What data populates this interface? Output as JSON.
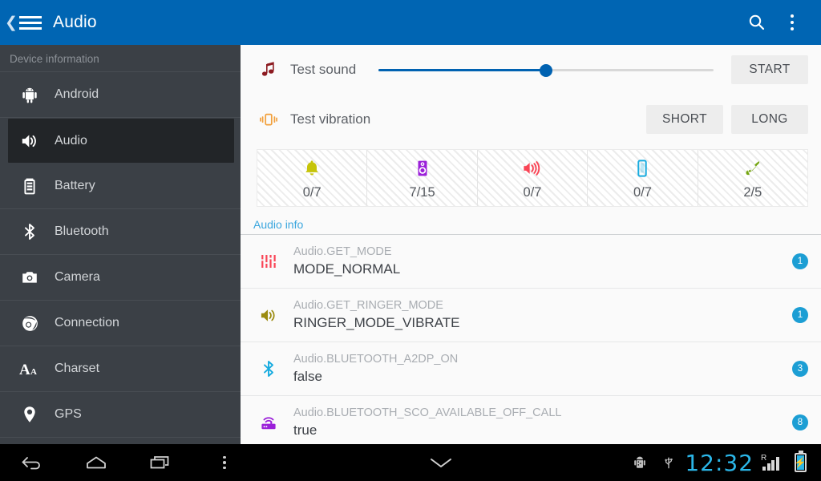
{
  "actionbar": {
    "back_icon": "chevron-left-icon",
    "menu_icon": "hamburger-menu-icon",
    "title": "Audio",
    "search_icon": "search-icon",
    "overflow_icon": "overflow-menu-icon"
  },
  "sidebar": {
    "header": "Device information",
    "items": [
      {
        "label": "Android",
        "icon": "android-icon",
        "selected": false
      },
      {
        "label": "Audio",
        "icon": "speaker-icon",
        "selected": true
      },
      {
        "label": "Battery",
        "icon": "battery-icon",
        "selected": false
      },
      {
        "label": "Bluetooth",
        "icon": "bluetooth-icon",
        "selected": false
      },
      {
        "label": "Camera",
        "icon": "camera-icon",
        "selected": false
      },
      {
        "label": "Connection",
        "icon": "connection-icon",
        "selected": false
      },
      {
        "label": "Charset",
        "icon": "charset-icon",
        "selected": false
      },
      {
        "label": "GPS",
        "icon": "gps-pin-icon",
        "selected": false
      }
    ]
  },
  "main": {
    "test_sound": {
      "icon": "music-note-icon",
      "icon_color": "#8c1a20",
      "label": "Test sound",
      "slider_percent": 50,
      "slider_color": "#0062b1",
      "button": "START"
    },
    "test_vibration": {
      "icon": "vibration-icon",
      "icon_color": "#f2a03c",
      "label": "Test vibration",
      "button_short": "SHORT",
      "button_long": "LONG"
    },
    "volumes": [
      {
        "icon": "bell-icon",
        "color": "#c6c409",
        "value": "0/7"
      },
      {
        "icon": "music-player-icon",
        "color": "#9b20d9",
        "value": "7/15"
      },
      {
        "icon": "alarm-volume-icon",
        "color": "#f94455",
        "value": "0/7"
      },
      {
        "icon": "phone-device-icon",
        "color": "#16abdf",
        "value": "0/7"
      },
      {
        "icon": "call-handset-icon",
        "color": "#75a612",
        "value": "2/5"
      }
    ],
    "section_title": "Audio info",
    "section_title_color": "#3aa6de",
    "info_rows": [
      {
        "icon": "equalizer-icon",
        "icon_color": "#f94455",
        "key": "Audio.GET_MODE",
        "value": "MODE_NORMAL",
        "badge": "1"
      },
      {
        "icon": "speaker-icon",
        "icon_color": "#9b8b10",
        "key": "Audio.GET_RINGER_MODE",
        "value": "RINGER_MODE_VIBRATE",
        "badge": "1"
      },
      {
        "icon": "bluetooth-icon",
        "icon_color": "#16abdf",
        "key": "Audio.BLUETOOTH_A2DP_ON",
        "value": "false",
        "badge": "3"
      },
      {
        "icon": "hotspot-icon",
        "icon_color": "#9b20d9",
        "key": "Audio.BLUETOOTH_SCO_AVAILABLE_OFF_CALL",
        "value": "true",
        "badge": "8"
      }
    ]
  },
  "navbar": {
    "back_icon": "nav-back-icon",
    "home_icon": "nav-home-icon",
    "recents_icon": "nav-recents-icon",
    "menu_icon": "nav-overflow-icon",
    "collapse_icon": "chevron-down-icon",
    "status": {
      "debug_icon": "android-debug-icon",
      "usb_icon": "usb-icon",
      "clock": "12:32",
      "clock_color": "#2bb6e8",
      "roaming": "R",
      "signal_icon": "signal-bars-icon",
      "battery_icon": "battery-charging-icon"
    }
  }
}
